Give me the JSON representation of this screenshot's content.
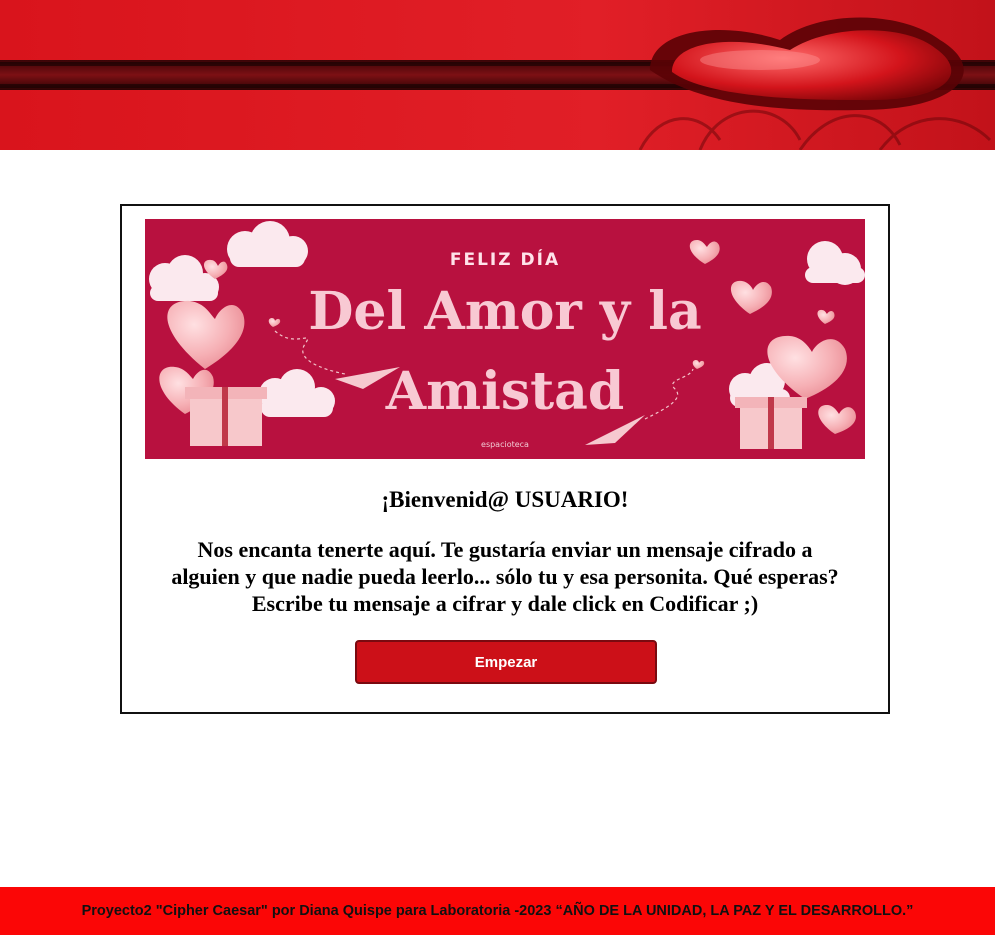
{
  "header": {
    "banner_icon": "heart-banner-image"
  },
  "card": {
    "image": {
      "kicker": "FELIZ DÍA",
      "title_line1": "Del Amor y la",
      "title_line2": "Amistad",
      "credit": "espacioteca"
    },
    "welcome_title": "¡Bienvenid@ USUARIO!",
    "welcome_text": "Nos encanta tenerte aquí. Te gustaría enviar un mensaje cifrado a alguien y que nadie pueda leerlo... sólo tu y esa personita. Qué esperas? Escribe tu mensaje a cifrar y dale click en Codificar ;)",
    "start_button_label": "Empezar"
  },
  "footer": {
    "text": "Proyecto2 \"Cipher Caesar\" por Diana Quispe para Laboratoria -2023 “AÑO DE LA UNIDAD, LA PAZ Y EL DESARROLLO.”"
  },
  "colors": {
    "accent_red": "#cc1018",
    "footer_red": "#fb0606",
    "card_image_bg": "#b8113f",
    "heart_pink": "#f6b3b8"
  }
}
